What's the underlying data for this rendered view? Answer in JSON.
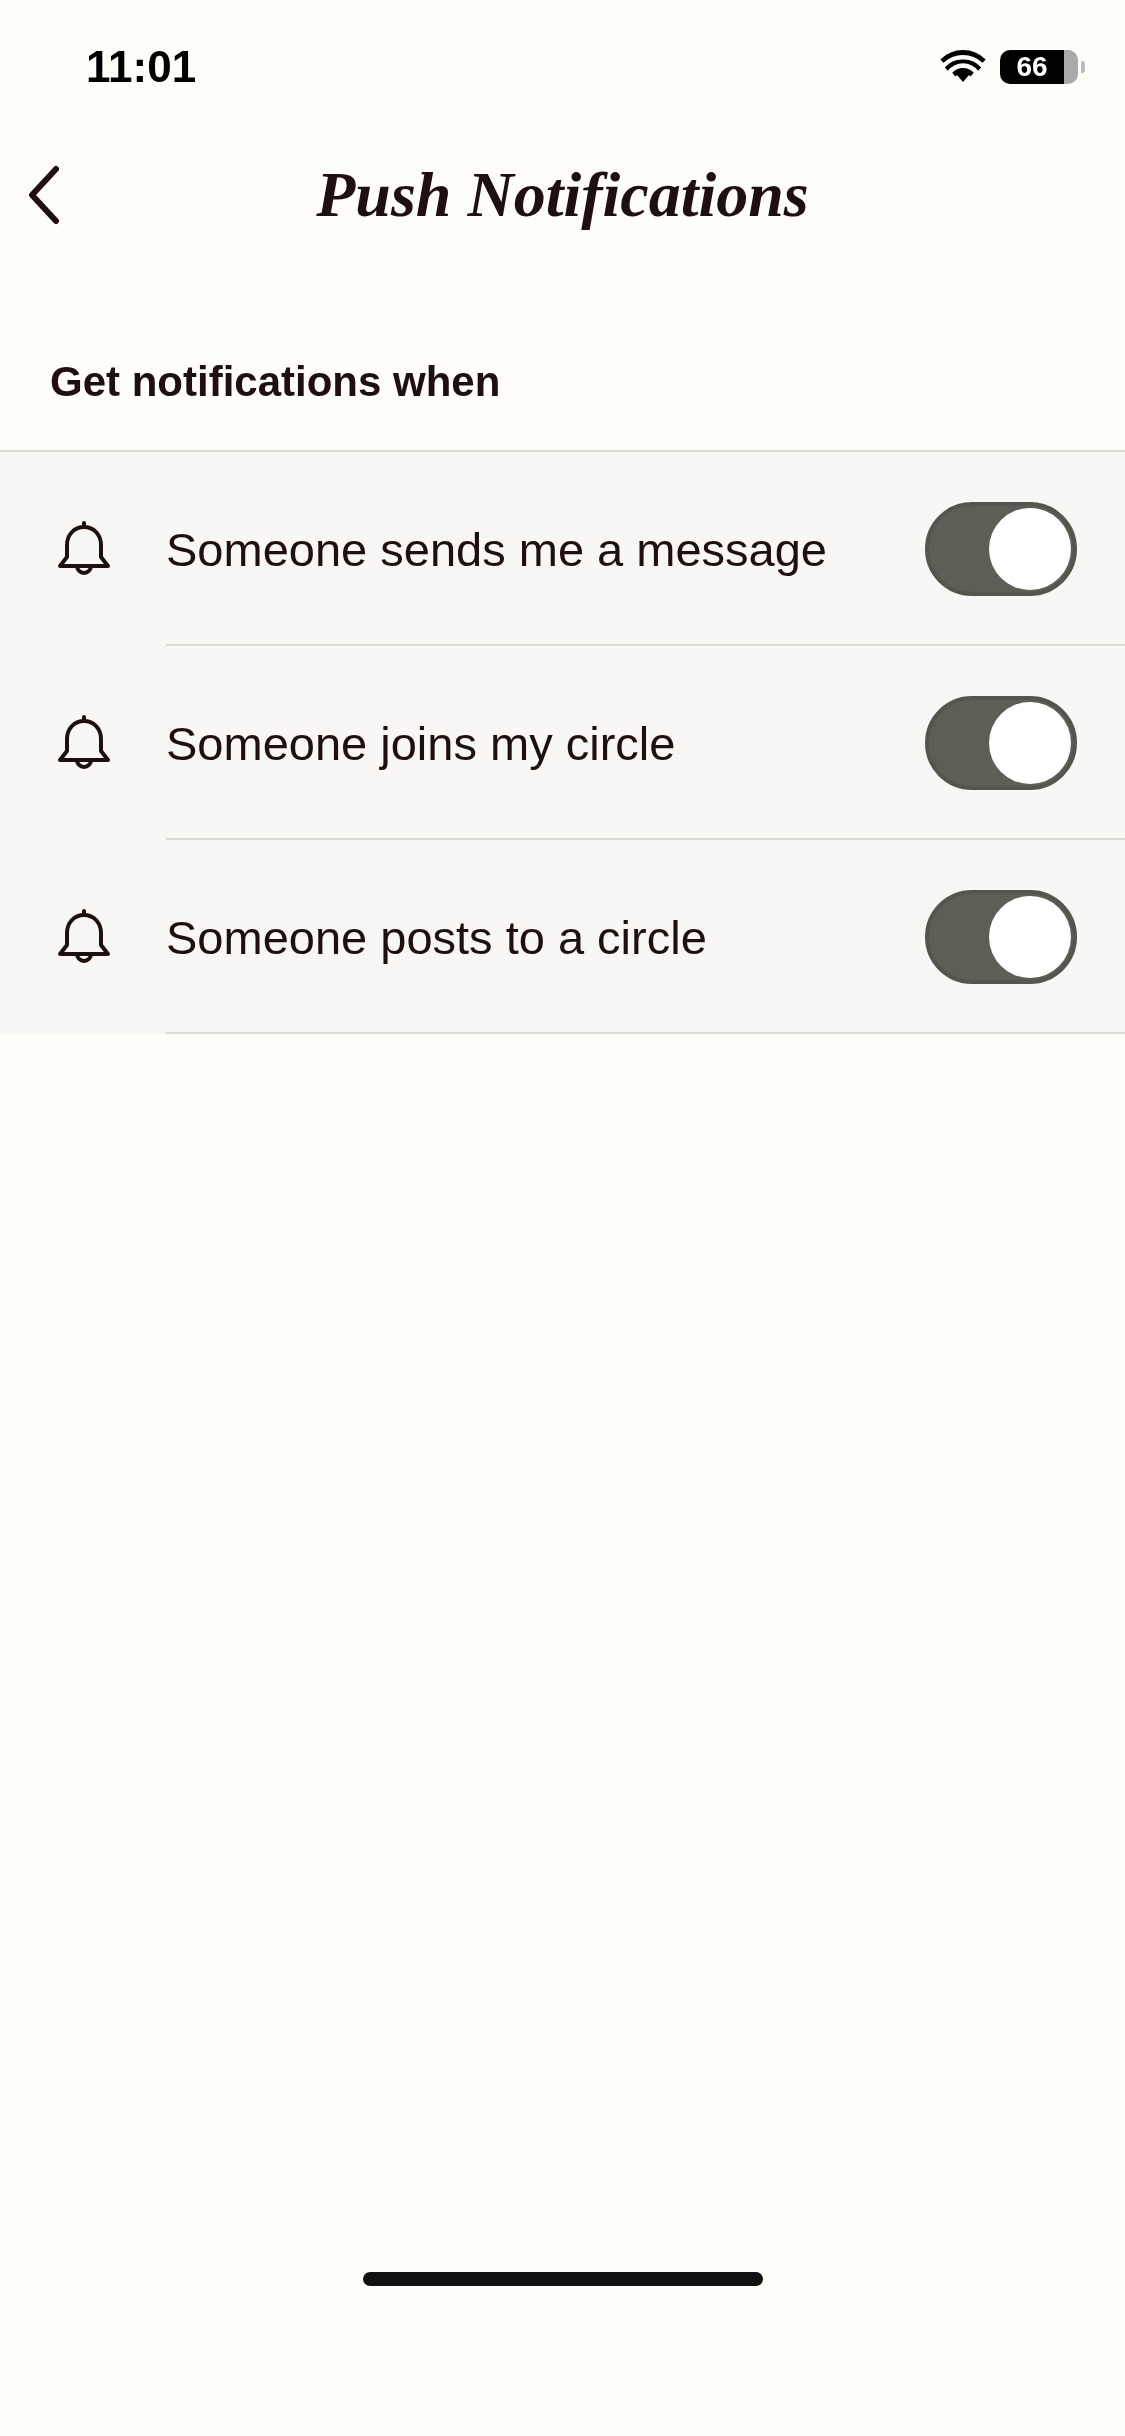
{
  "status_bar": {
    "time": "11:01",
    "battery": "66"
  },
  "header": {
    "title": "Push Notifications"
  },
  "section": {
    "title": "Get notifications when"
  },
  "settings": [
    {
      "label": "Someone sends me a message",
      "on": true
    },
    {
      "label": "Someone joins my circle",
      "on": true
    },
    {
      "label": "Someone posts to a circle",
      "on": true
    }
  ]
}
